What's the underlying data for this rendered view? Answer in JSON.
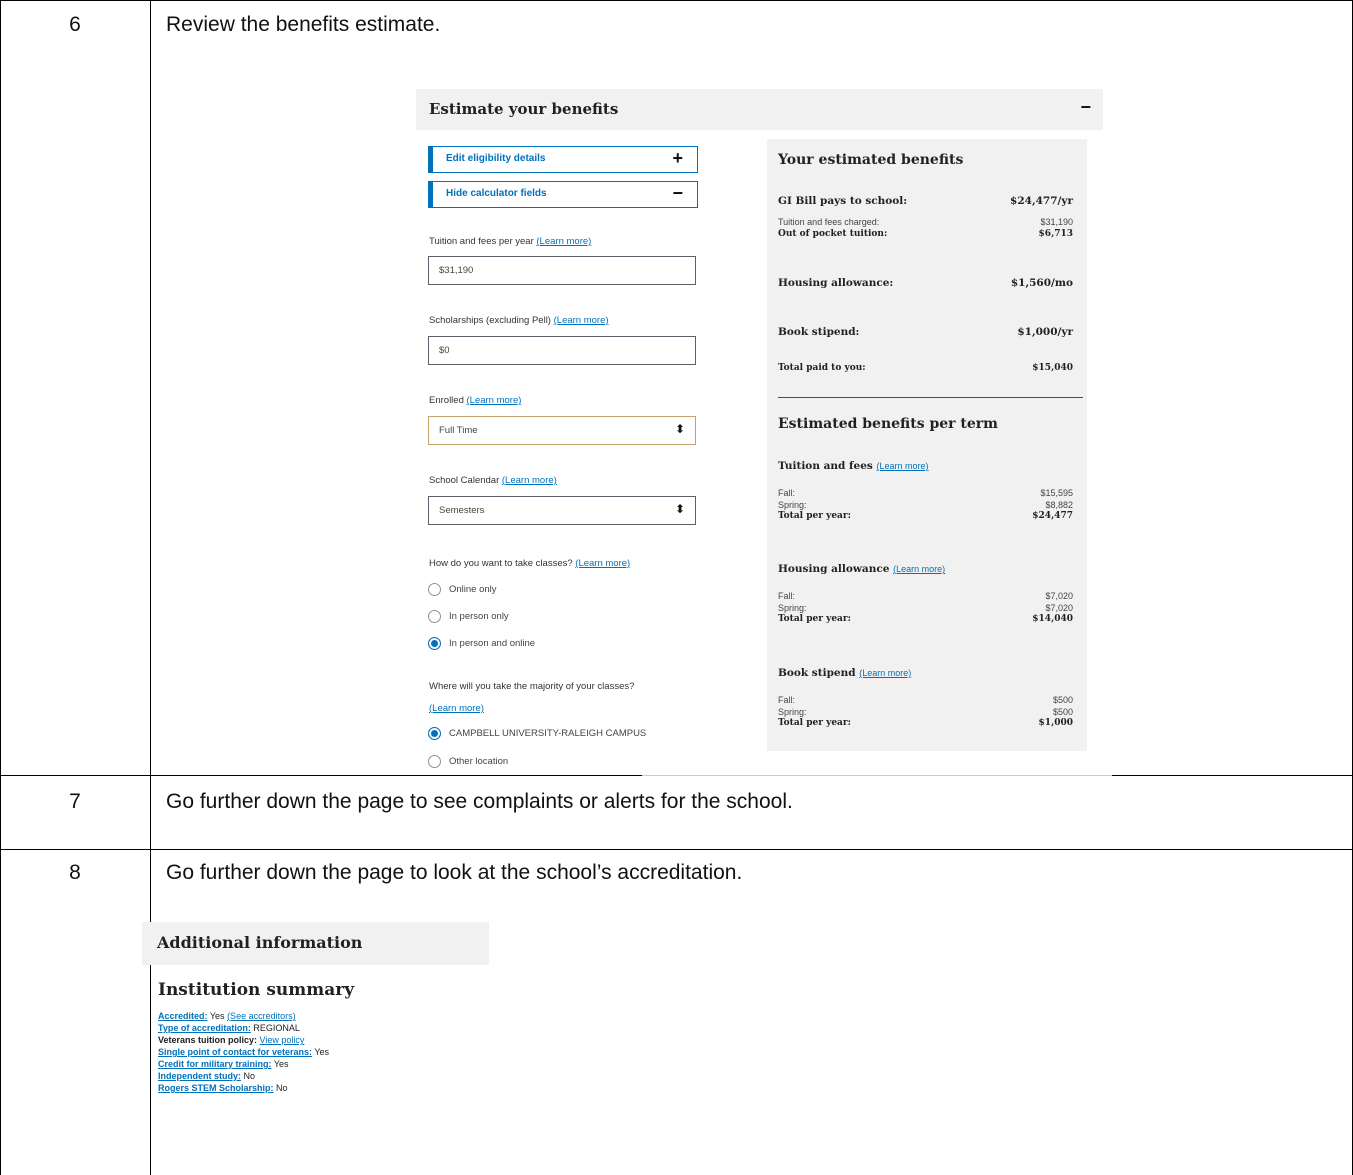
{
  "steps": [
    {
      "number": "6",
      "text": "Review the benefits estimate."
    },
    {
      "number": "7",
      "text": "Go further down the page to see complaints or alerts for the school."
    },
    {
      "number": "8",
      "text": "Go further down the page to look at the school’s accreditation."
    }
  ],
  "estimator": {
    "title": "Estimate your benefits",
    "collapse_symbol": "−",
    "edit_eligibility": {
      "label": "Edit eligibility details",
      "symbol": "+"
    },
    "hide_calculator": {
      "label": "Hide calculator fields",
      "symbol": "−"
    },
    "tuition": {
      "label": "Tuition and fees per year",
      "link": "(Learn more)",
      "value": "$31,190"
    },
    "scholarships": {
      "label": "Scholarships (excluding Pell)",
      "link": "(Learn more)",
      "value": "$0"
    },
    "enrolled": {
      "label": "Enrolled",
      "link": "(Learn more)",
      "value": "Full Time"
    },
    "calendar": {
      "label": "School Calendar",
      "link": "(Learn more)",
      "value": "Semesters"
    },
    "classes": {
      "label": "How do you want to take classes?",
      "link": "(Learn more)",
      "options": [
        "Online only",
        "In person only",
        "In person and online"
      ],
      "selected": "In person and online"
    },
    "location": {
      "label": "Where will you take the majority of your classes?",
      "link": "(Learn more)",
      "options": [
        "CAMPBELL UNIVERSITY-RALEIGH CAMPUS",
        "Other location"
      ],
      "selected": "CAMPBELL UNIVERSITY-RALEIGH CAMPUS"
    }
  },
  "benefits": {
    "title": "Your estimated benefits",
    "gi_bill_pays": {
      "label": "GI Bill pays to school:",
      "value": "$24,477/yr"
    },
    "tuition_charged": {
      "label": "Tuition and fees charged:",
      "value": "$31,190"
    },
    "out_of_pocket": {
      "label": "Out of pocket tuition:",
      "value": "$6,713"
    },
    "housing": {
      "label": "Housing allowance:",
      "value": "$1,560/mo"
    },
    "book": {
      "label": "Book stipend:",
      "value": "$1,000/yr"
    },
    "total_paid": {
      "label": "Total paid to you:",
      "value": "$15,040"
    },
    "per_term_title": "Estimated benefits per term",
    "link": "(Learn more)",
    "tuition_term": {
      "title": "Tuition and fees",
      "fall": "$15,595",
      "spring": "$8,882",
      "total": "$24,477"
    },
    "housing_term": {
      "title": "Housing allowance",
      "fall": "$7,020",
      "spring": "$7,020",
      "total": "$14,040"
    },
    "book_term": {
      "title": "Book stipend",
      "fall": "$500",
      "spring": "$500",
      "total": "$1,000"
    },
    "fall_label": "Fall:",
    "spring_label": "Spring:",
    "total_label": "Total per year:"
  },
  "additional": {
    "title": "Additional information",
    "summary_title": "Institution summary",
    "rows": [
      {
        "key": "Accredited:",
        "link_key": true,
        "value": "Yes",
        "link": "(See accreditors)"
      },
      {
        "key": "Type of accreditation:",
        "link_key": true,
        "value": "REGIONAL",
        "link": ""
      },
      {
        "key": "Veterans tuition policy:",
        "link_key": false,
        "value": "",
        "link": "View policy"
      },
      {
        "key": "Single point of contact for veterans:",
        "link_key": true,
        "value": "Yes",
        "link": ""
      },
      {
        "key": "Credit for military training:",
        "link_key": true,
        "value": "Yes",
        "link": ""
      },
      {
        "key": "Independent study:",
        "link_key": true,
        "value": "No",
        "link": ""
      },
      {
        "key": "Rogers STEM Scholarship:",
        "link_key": true,
        "value": "No",
        "link": ""
      }
    ]
  }
}
